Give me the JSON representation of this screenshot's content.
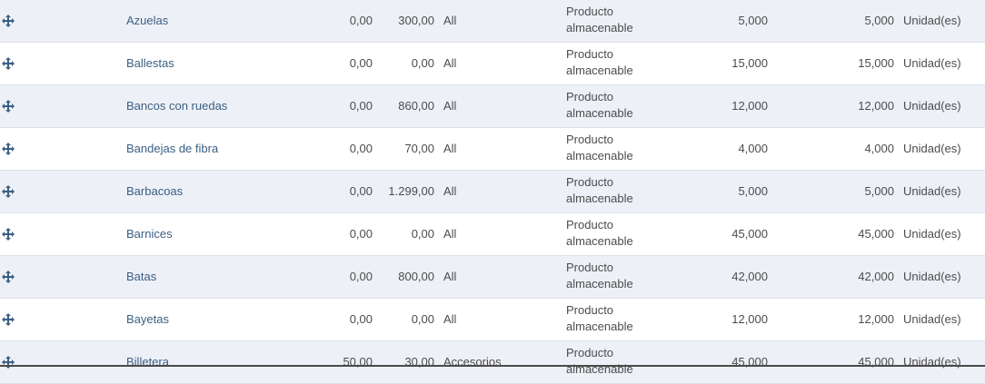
{
  "products": [
    {
      "name": "Azuelas",
      "cost": "0,00",
      "price": "300,00",
      "category": "All",
      "type_line1": "Producto",
      "type_line2": "almacenable",
      "qty_on_hand": "5,000",
      "forecast_qty": "5,000",
      "uom": "Unidad(es)"
    },
    {
      "name": "Ballestas",
      "cost": "0,00",
      "price": "0,00",
      "category": "All",
      "type_line1": "Producto",
      "type_line2": "almacenable",
      "qty_on_hand": "15,000",
      "forecast_qty": "15,000",
      "uom": "Unidad(es)"
    },
    {
      "name": "Bancos con ruedas",
      "cost": "0,00",
      "price": "860,00",
      "category": "All",
      "type_line1": "Producto",
      "type_line2": "almacenable",
      "qty_on_hand": "12,000",
      "forecast_qty": "12,000",
      "uom": "Unidad(es)"
    },
    {
      "name": "Bandejas de fibra",
      "cost": "0,00",
      "price": "70,00",
      "category": "All",
      "type_line1": "Producto",
      "type_line2": "almacenable",
      "qty_on_hand": "4,000",
      "forecast_qty": "4,000",
      "uom": "Unidad(es)"
    },
    {
      "name": "Barbacoas",
      "cost": "0,00",
      "price": "1.299,00",
      "category": "All",
      "type_line1": "Producto",
      "type_line2": "almacenable",
      "qty_on_hand": "5,000",
      "forecast_qty": "5,000",
      "uom": "Unidad(es)"
    },
    {
      "name": "Barnices",
      "cost": "0,00",
      "price": "0,00",
      "category": "All",
      "type_line1": "Producto",
      "type_line2": "almacenable",
      "qty_on_hand": "45,000",
      "forecast_qty": "45,000",
      "uom": "Unidad(es)"
    },
    {
      "name": "Batas",
      "cost": "0,00",
      "price": "800,00",
      "category": "All",
      "type_line1": "Producto",
      "type_line2": "almacenable",
      "qty_on_hand": "42,000",
      "forecast_qty": "42,000",
      "uom": "Unidad(es)"
    },
    {
      "name": "Bayetas",
      "cost": "0,00",
      "price": "0,00",
      "category": "All",
      "type_line1": "Producto",
      "type_line2": "almacenable",
      "qty_on_hand": "12,000",
      "forecast_qty": "12,000",
      "uom": "Unidad(es)"
    },
    {
      "name": "Billetera",
      "cost": "50,00",
      "price": "30,00",
      "category": "Accesorios",
      "type_line1": "Producto",
      "type_line2": "almacenable",
      "qty_on_hand": "45,000",
      "forecast_qty": "45,000",
      "uom": "Unidad(es)"
    }
  ],
  "icons": {
    "drag_handle": "move-arrows-icon"
  },
  "colors": {
    "row_alt": "#eef0f7",
    "name_text": "#3a5f82",
    "handle": "#3a5f82"
  }
}
